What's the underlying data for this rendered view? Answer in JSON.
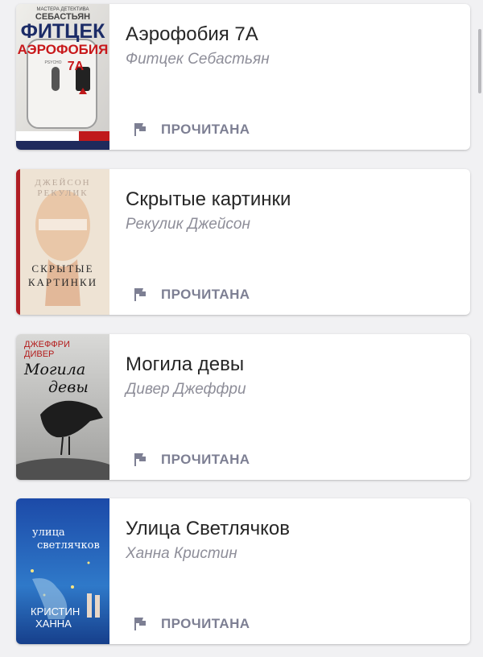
{
  "books": [
    {
      "title": "Аэрофобия 7А",
      "author": "Фитцек Себастьян",
      "status": "ПРОЧИТАНА",
      "cover_text": [
        "МАСТЕРА ДЕТЕКТИВА",
        "СЕБАСТЬЯН",
        "ФИТЦЕК",
        "АЭРОФОБИЯ",
        "7А",
        "PSYCHO"
      ]
    },
    {
      "title": "Скрытые картинки",
      "author": "Рекулик Джейсон",
      "status": "ПРОЧИТАНА",
      "cover_text": [
        "ДЖЕЙСОН",
        "РЕКУЛИК",
        "СКРЫТЫЕ",
        "КАРТИНКИ"
      ]
    },
    {
      "title": "Могила девы",
      "author": "Дивер Джеффри",
      "status": "ПРОЧИТАНА",
      "cover_text": [
        "ДЖЕФФРИ",
        "ДИВЕР",
        "Могила",
        "девы"
      ]
    },
    {
      "title": "Улица Светлячков",
      "author": "Ханна Кристин",
      "status": "ПРОЧИТАНА",
      "cover_text": [
        "улица",
        "светлячков",
        "КРИСТИН",
        "ХАННА"
      ]
    }
  ],
  "colors": {
    "background": "#f1f1f3",
    "card": "#ffffff",
    "title": "#262626",
    "author": "#8e8e99",
    "status": "#7d7f93"
  },
  "icons": {
    "status": "flag-icon"
  }
}
